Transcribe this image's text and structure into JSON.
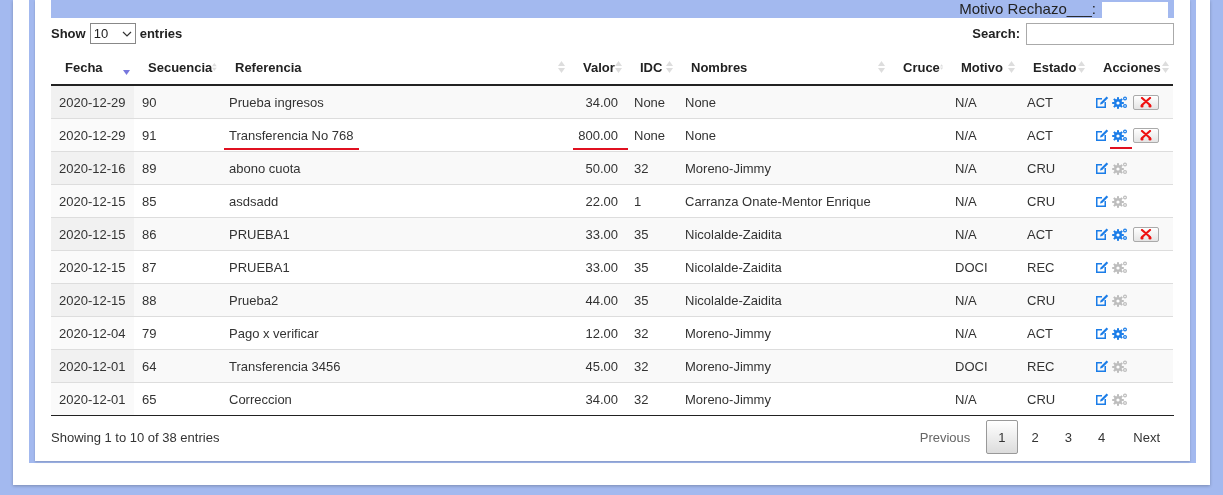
{
  "filter_band": {
    "label": "Motivo Rechazo___:"
  },
  "length_control": {
    "prefix": "Show",
    "value": "10",
    "suffix": "entries"
  },
  "search": {
    "label": "Search:"
  },
  "table": {
    "columns": [
      {
        "label": "Fecha",
        "sorted": true
      },
      {
        "label": "Secuencia",
        "sorted": false
      },
      {
        "label": "Referencia",
        "sorted": false
      },
      {
        "label": "Valor",
        "sorted": false
      },
      {
        "label": "IDC",
        "sorted": false
      },
      {
        "label": "Nombres",
        "sorted": false
      },
      {
        "label": "Cruce",
        "sorted": false
      },
      {
        "label": "Motivo",
        "sorted": false
      },
      {
        "label": "Estado",
        "sorted": false
      },
      {
        "label": "Acciones",
        "sorted": false
      }
    ],
    "rows": [
      {
        "fecha": "2020-12-29",
        "secuencia": "90",
        "referencia": "Prueba ingresos",
        "valor": "34.00",
        "idc": "None",
        "nombres": "None",
        "motivo": "N/A",
        "estado": "ACT",
        "config_enabled": true,
        "delete": true
      },
      {
        "fecha": "2020-12-29",
        "secuencia": "91",
        "referencia": "Transferencia No 768",
        "valor": "800.00",
        "idc": "None",
        "nombres": "None",
        "motivo": "N/A",
        "estado": "ACT",
        "config_enabled": true,
        "delete": true,
        "marked": {
          "referencia": true,
          "valor": true,
          "config": true
        }
      },
      {
        "fecha": "2020-12-16",
        "secuencia": "89",
        "referencia": "abono cuota",
        "valor": "50.00",
        "idc": "32",
        "nombres": "Moreno-Jimmy",
        "motivo": "N/A",
        "estado": "CRU",
        "config_enabled": false,
        "delete": false
      },
      {
        "fecha": "2020-12-15",
        "secuencia": "85",
        "referencia": "asdsadd",
        "valor": "22.00",
        "idc": "1",
        "nombres": "Carranza Onate-Mentor Enrique",
        "motivo": "N/A",
        "estado": "CRU",
        "config_enabled": false,
        "delete": false
      },
      {
        "fecha": "2020-12-15",
        "secuencia": "86",
        "referencia": "PRUEBA1",
        "valor": "33.00",
        "idc": "35",
        "nombres": "Nicolalde-Zaidita",
        "motivo": "N/A",
        "estado": "ACT",
        "config_enabled": true,
        "delete": true
      },
      {
        "fecha": "2020-12-15",
        "secuencia": "87",
        "referencia": "PRUEBA1",
        "valor": "33.00",
        "idc": "35",
        "nombres": "Nicolalde-Zaidita",
        "motivo": "DOCI",
        "estado": "REC",
        "config_enabled": false,
        "delete": false
      },
      {
        "fecha": "2020-12-15",
        "secuencia": "88",
        "referencia": "Prueba2",
        "valor": "44.00",
        "idc": "35",
        "nombres": "Nicolalde-Zaidita",
        "motivo": "N/A",
        "estado": "CRU",
        "config_enabled": false,
        "delete": false
      },
      {
        "fecha": "2020-12-04",
        "secuencia": "79",
        "referencia": "Pago x verificar",
        "valor": "12.00",
        "idc": "32",
        "nombres": "Moreno-Jimmy",
        "motivo": "N/A",
        "estado": "ACT",
        "config_enabled": true,
        "delete": false
      },
      {
        "fecha": "2020-12-01",
        "secuencia": "64",
        "referencia": "Transferencia 3456",
        "valor": "45.00",
        "idc": "32",
        "nombres": "Moreno-Jimmy",
        "motivo": "DOCI",
        "estado": "REC",
        "config_enabled": false,
        "delete": false
      },
      {
        "fecha": "2020-12-01",
        "secuencia": "65",
        "referencia": "Correccion",
        "valor": "34.00",
        "idc": "32",
        "nombres": "Moreno-Jimmy",
        "motivo": "N/A",
        "estado": "CRU",
        "config_enabled": false,
        "delete": false
      }
    ]
  },
  "info": "Showing 1 to 10 of 38 entries",
  "pagination": [
    {
      "label": "Previous",
      "kind": "nav",
      "disabled": true,
      "selected": false
    },
    {
      "label": "1",
      "kind": "page",
      "disabled": false,
      "selected": true
    },
    {
      "label": "2",
      "kind": "page",
      "disabled": false,
      "selected": false
    },
    {
      "label": "3",
      "kind": "page",
      "disabled": false,
      "selected": false
    },
    {
      "label": "4",
      "kind": "page",
      "disabled": false,
      "selected": false
    },
    {
      "label": "Next",
      "kind": "nav",
      "disabled": false,
      "selected": false
    }
  ]
}
